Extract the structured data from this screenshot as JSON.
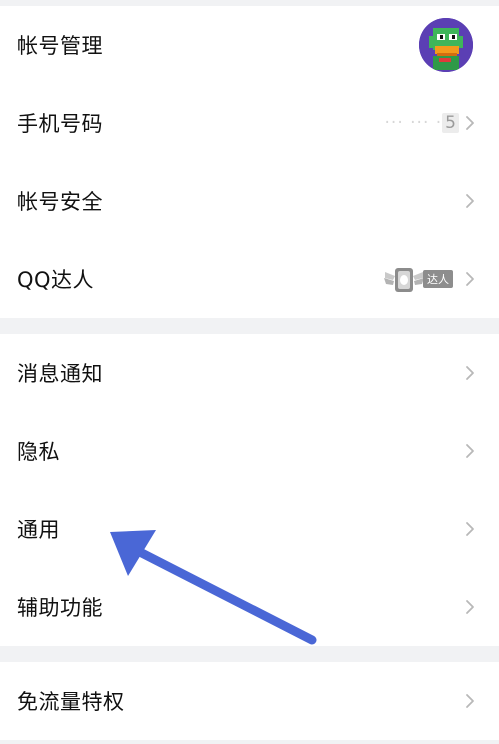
{
  "group1": {
    "account_label": "帐号管理",
    "phone_label": "手机号码",
    "phone_masked": "··· ··· ·",
    "phone_last": "5",
    "security_label": "帐号安全",
    "qq_label": "QQ达人",
    "qq_badge_text": "达人"
  },
  "group2": {
    "notify_label": "消息通知",
    "privacy_label": "隐私",
    "general_label": "通用",
    "assist_label": "辅助功能"
  },
  "group3": {
    "free_flow_label": "免流量特权"
  },
  "colors": {
    "annotation_arrow": "#4a67d6",
    "chevron": "#b8b8b8",
    "separator": "#f1f2f4"
  },
  "icons": {
    "avatar": "green-duck-avatar",
    "chevron": "chevron-right-icon",
    "qq_badge": "winged-badge-icon"
  }
}
